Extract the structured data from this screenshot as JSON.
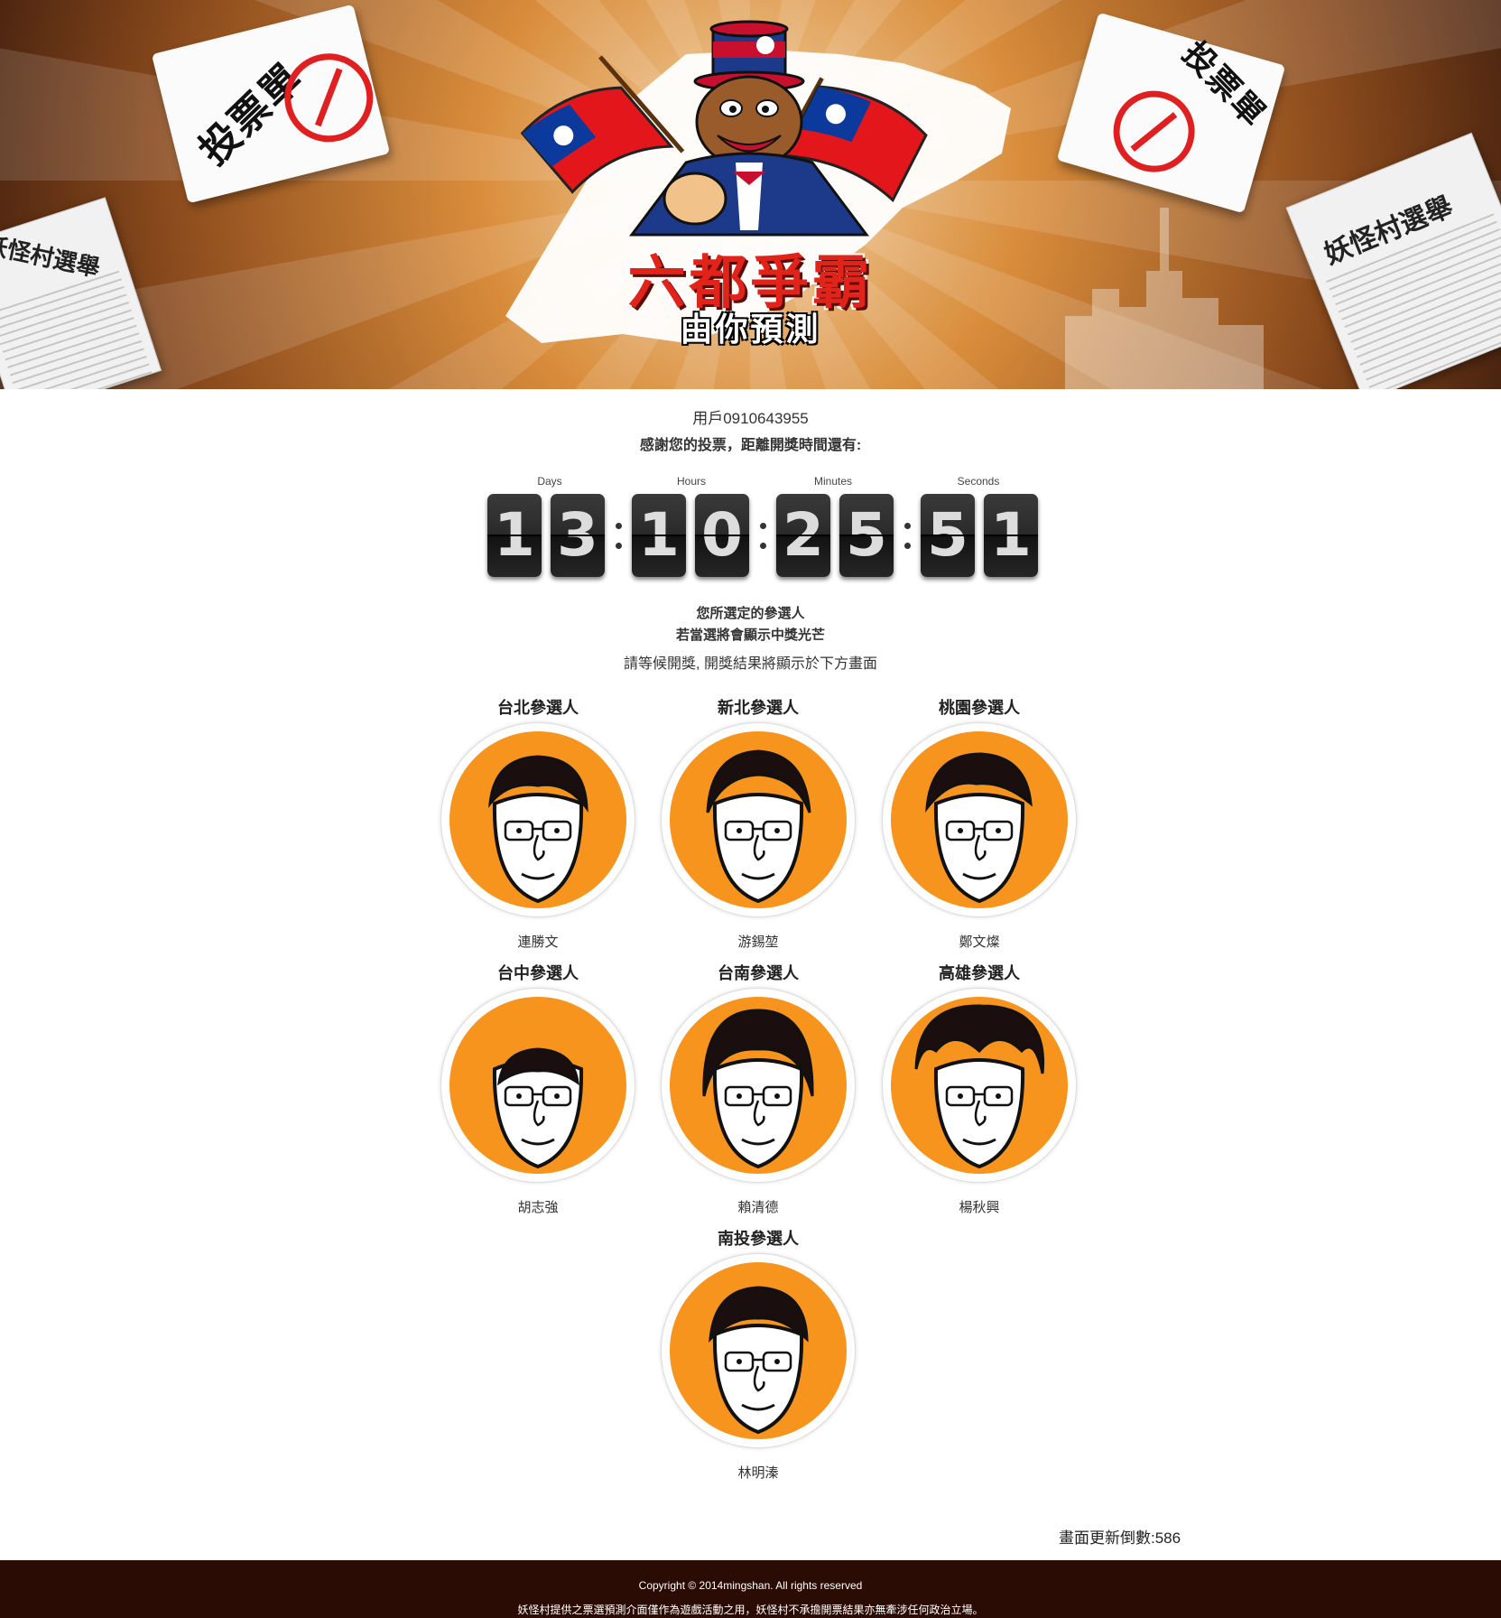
{
  "banner": {
    "ballot_label": "投票單",
    "newspaper_title": "妖怪村選舉",
    "headline": "六都爭霸",
    "subheadline": "由你預測"
  },
  "user": {
    "label": "用戶0910643955"
  },
  "thanks_text": "感謝您的投票，距離開獎時間還有:",
  "countdown": {
    "labels": [
      "Days",
      "Hours",
      "Minutes",
      "Seconds"
    ],
    "digits": [
      "1",
      "3",
      "1",
      "0",
      "2",
      "5",
      "5",
      "1"
    ]
  },
  "notes": {
    "line1": "您所選定的參選人",
    "line2": "若當選將會顯示中獎光芒",
    "line3": "請等候開獎, 開獎結果將顯示於下方畫面"
  },
  "candidates": [
    {
      "region": "台北參選人",
      "name": "連勝文"
    },
    {
      "region": "新北參選人",
      "name": "游錫堃"
    },
    {
      "region": "桃園參選人",
      "name": "鄭文燦"
    },
    {
      "region": "台中參選人",
      "name": "胡志強"
    },
    {
      "region": "台南參選人",
      "name": "賴清德"
    },
    {
      "region": "高雄參選人",
      "name": "楊秋興"
    },
    {
      "region": "南投參選人",
      "name": "林明溱"
    }
  ],
  "refresh": {
    "label": "畫面更新倒數:586"
  },
  "footer": {
    "copyright": "Copyright © 2014mingshan. All rights reserved",
    "disclaimer": "妖怪村提供之票選預測介面僅作為遊戲活動之用，妖怪村不承擔開票結果亦無牽涉任何政治立場。"
  },
  "colors": {
    "accent_orange": "#f7941d",
    "footer_bg": "#2b0c04",
    "headline_red": "#e2231a"
  },
  "icons": [
    "ballot-stamp-icon",
    "taiwan-flag-icon",
    "mascot-illustration"
  ]
}
